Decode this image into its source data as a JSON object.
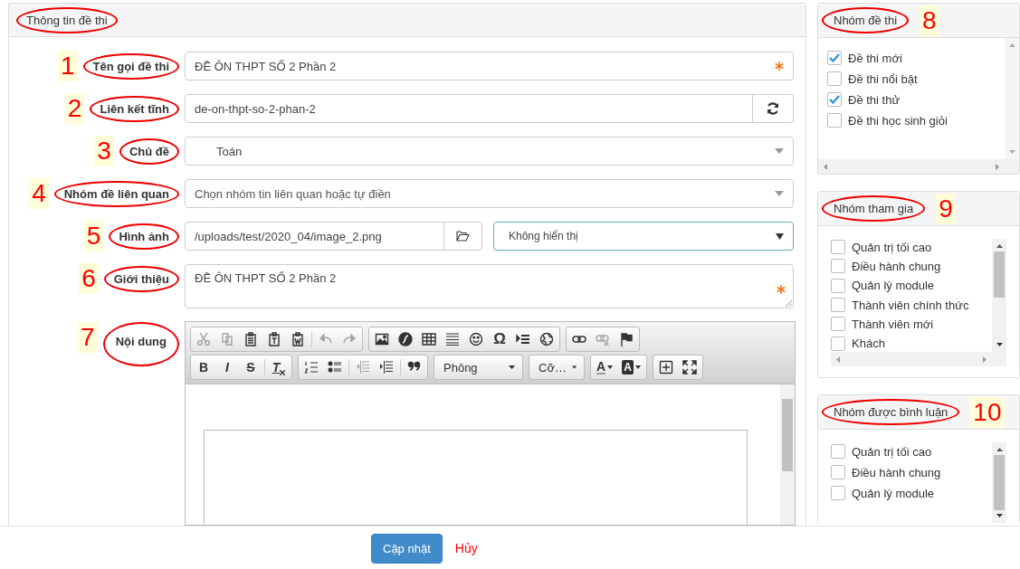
{
  "panel": {
    "title": "Thông tin đề thi",
    "circled": true
  },
  "fields": [
    {
      "kind": "text",
      "label": "Tên gọi đề thi",
      "marker": "1",
      "circled": true,
      "value": "ĐỀ ÔN THPT SỐ 2 Phần 2",
      "required": true
    },
    {
      "kind": "link",
      "label": "Liên kết tĩnh",
      "marker": "2",
      "circled": true,
      "value": "de-on-thpt-so-2-phan-2"
    },
    {
      "kind": "select",
      "label": "Chủ đề",
      "marker": "3",
      "circled": true,
      "value": "Toán"
    },
    {
      "kind": "combo",
      "label": "Nhóm đề liên quan",
      "marker": "4",
      "circled": true,
      "placeholder": "Chọn nhóm tin liên quan hoặc tự điền"
    },
    {
      "kind": "image",
      "label": "Hình ảnh",
      "marker": "5",
      "circled": true,
      "value": "/uploads/test/2020_04/image_2.png",
      "option": "Không hiển thị"
    },
    {
      "kind": "textarea",
      "label": "Giới thiệu",
      "marker": "6",
      "circled": true,
      "value": "ĐỀ ÔN THPT SỐ 2 Phần 2",
      "required": true
    }
  ],
  "editor": {
    "label": "Nội dung",
    "marker": "7",
    "circled": true,
    "toolbar": [
      [
        [
          {
            "kind": "cut",
            "disabled": true
          },
          {
            "kind": "copy",
            "disabled": true
          },
          {
            "kind": "paste",
            "disabled": false
          },
          {
            "kind": "paste-text",
            "disabled": false
          },
          {
            "kind": "paste-word",
            "disabled": false
          },
          {
            "kind": "sep"
          },
          {
            "kind": "undo",
            "disabled": true
          },
          {
            "kind": "redo",
            "disabled": true
          }
        ],
        [
          {
            "kind": "image",
            "disabled": false
          },
          {
            "kind": "flash",
            "disabled": false
          },
          {
            "kind": "table",
            "disabled": false
          },
          {
            "kind": "hline",
            "disabled": false
          },
          {
            "kind": "smiley",
            "disabled": false
          },
          {
            "kind": "char",
            "text": "Ω",
            "disabled": false
          },
          {
            "kind": "pagebreak",
            "disabled": false
          },
          {
            "kind": "globe",
            "disabled": false
          }
        ],
        [
          {
            "kind": "link",
            "disabled": false
          },
          {
            "kind": "unlink",
            "disabled": true
          },
          {
            "kind": "flag",
            "disabled": false
          }
        ]
      ],
      [
        [
          {
            "kind": "bold",
            "text": "B",
            "disabled": false
          },
          {
            "kind": "italic",
            "text": "I",
            "disabled": false
          },
          {
            "kind": "strike",
            "text": "S",
            "disabled": false
          },
          {
            "kind": "sep"
          },
          {
            "kind": "clear",
            "text": "T",
            "disabled": false
          }
        ],
        [
          {
            "kind": "numlist",
            "disabled": false
          },
          {
            "kind": "bullist",
            "disabled": false
          },
          {
            "kind": "sep"
          },
          {
            "kind": "outdent",
            "disabled": true
          },
          {
            "kind": "indent",
            "disabled": false
          },
          {
            "kind": "sep"
          },
          {
            "kind": "quote",
            "disabled": false
          }
        ],
        [
          {
            "kind": "dropdown",
            "text": "Phông",
            "wide": true
          }
        ],
        [
          {
            "kind": "dropdown",
            "text": "Cỡ…",
            "wide": false
          }
        ],
        [
          {
            "kind": "textcolor",
            "text": "A",
            "disabled": false
          },
          {
            "kind": "bgcolor",
            "text": "A",
            "disabled": false
          }
        ],
        [
          {
            "kind": "showblocks",
            "disabled": false
          },
          {
            "kind": "maximize",
            "disabled": false
          }
        ]
      ]
    ]
  },
  "groups": [
    {
      "title": "Nhóm đề thi",
      "marker": "8",
      "circled": true,
      "inner": false,
      "items": [
        {
          "label": "Đề thi mới",
          "checked": true
        },
        {
          "label": "Đề thi nổi bật",
          "checked": false
        },
        {
          "label": "Đề thi thử",
          "checked": true
        },
        {
          "label": "Đề thi học sinh giỏi",
          "checked": false
        }
      ]
    },
    {
      "title": "Nhóm tham gia",
      "marker": "9",
      "circled": true,
      "inner": true,
      "items": [
        {
          "label": "Quản trị tối cao",
          "checked": false
        },
        {
          "label": "Điều hành chung",
          "checked": false
        },
        {
          "label": "Quản lý module",
          "checked": false
        },
        {
          "label": "Thành viên chính thức",
          "checked": false
        },
        {
          "label": "Thành viên mới",
          "checked": false
        },
        {
          "label": "Khách",
          "checked": false
        }
      ]
    },
    {
      "title": "Nhóm được bình luận",
      "marker": "10",
      "circled": true,
      "inner": true,
      "items": [
        {
          "label": "Quản trị tối cao",
          "checked": false
        },
        {
          "label": "Điều hành chung",
          "checked": false
        },
        {
          "label": "Quản lý module",
          "checked": false
        }
      ]
    }
  ],
  "footer": {
    "submit": "Cập nhật",
    "cancel": "Hủy"
  }
}
